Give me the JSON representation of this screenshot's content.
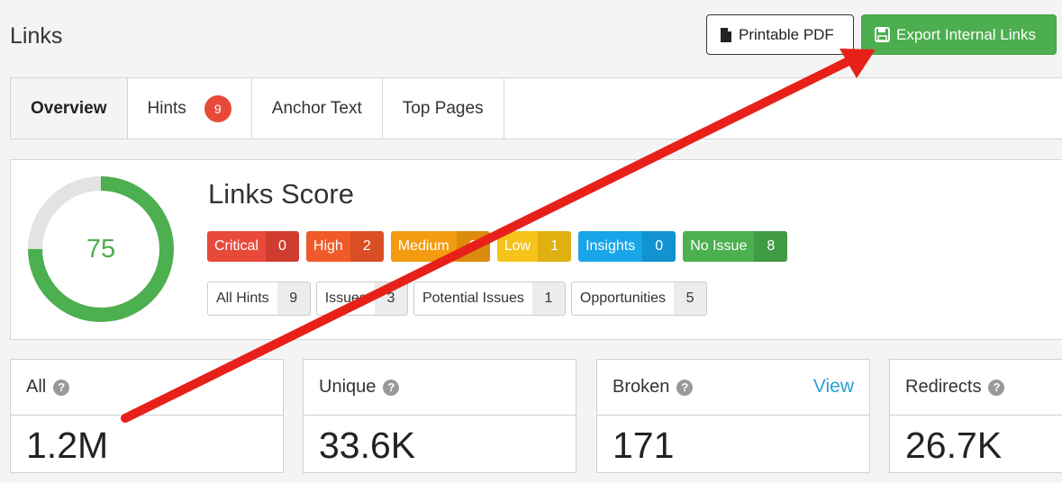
{
  "header": {
    "title": "Links",
    "pdf_button": "Printable PDF",
    "export_button": "Export Internal Links",
    "pdf_icon": "document-icon",
    "export_icon": "floppy-disk-icon"
  },
  "tabs": [
    {
      "label": "Overview",
      "active": true
    },
    {
      "label": "Hints",
      "badge": "9"
    },
    {
      "label": "Anchor Text"
    },
    {
      "label": "Top Pages"
    }
  ],
  "score": {
    "value": "75",
    "fraction": 0.75,
    "title": "Links Score",
    "colors": {
      "fill": "#4caf50",
      "track": "#e3e3e3"
    }
  },
  "severities": [
    {
      "label": "Critical",
      "count": "0",
      "color": "#e84a3a",
      "count_color": "#d03c2f"
    },
    {
      "label": "High",
      "count": "2",
      "color": "#f05a2a",
      "count_color": "#d94e22"
    },
    {
      "label": "Medium",
      "count": "3",
      "color": "#f39c12",
      "count_color": "#dc8b0d"
    },
    {
      "label": "Low",
      "count": "1",
      "color": "#f5c31a",
      "count_color": "#e0b010"
    },
    {
      "label": "Insights",
      "count": "0",
      "color": "#18a6e8",
      "count_color": "#1292cf"
    },
    {
      "label": "No Issue",
      "count": "8",
      "color": "#4caf50",
      "count_color": "#419a44"
    }
  ],
  "hint_filters": [
    {
      "label": "All Hints",
      "count": "9"
    },
    {
      "label": "Issues",
      "count": "3"
    },
    {
      "label": "Potential Issues",
      "count": "1"
    },
    {
      "label": "Opportunities",
      "count": "5"
    }
  ],
  "cards": [
    {
      "label": "All",
      "value": "1.2M"
    },
    {
      "label": "Unique",
      "value": "33.6K"
    },
    {
      "label": "Broken",
      "value": "171",
      "link": "View"
    },
    {
      "label": "Redirects",
      "value": "26.7K"
    }
  ],
  "annotation": {
    "color": "#e8201a",
    "icon": "arrow-annotation"
  }
}
